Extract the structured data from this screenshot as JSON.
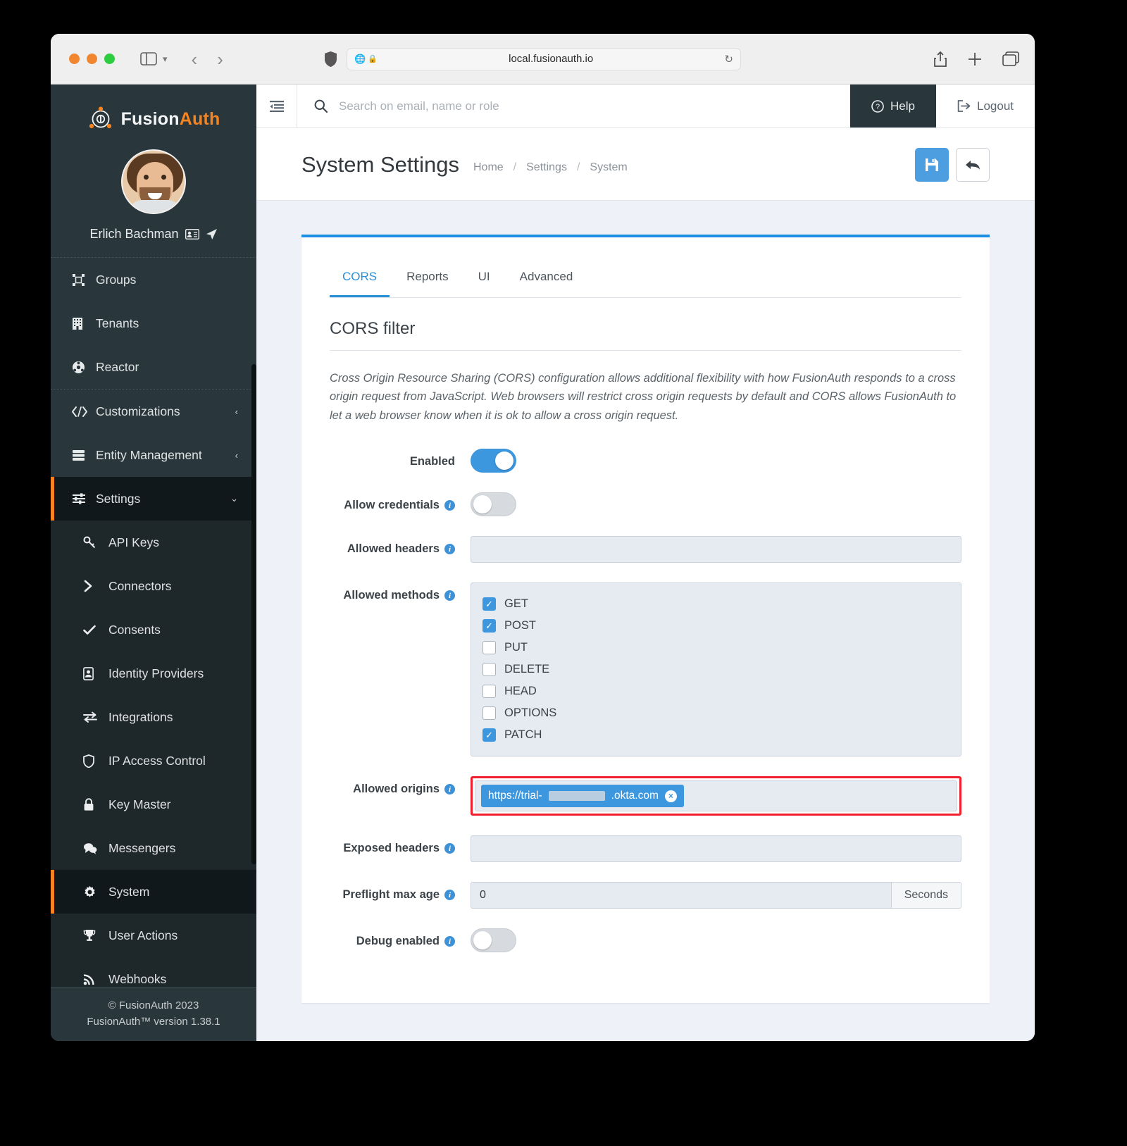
{
  "browser": {
    "url": "local.fusionauth.io",
    "reload_icon": "reload-icon",
    "share_icon": "share-icon",
    "newtab_icon": "plus-icon",
    "tabs_icon": "tabs-icon",
    "shield_icon": "shield-icon",
    "back_icon": "chevron-left-icon",
    "forward_icon": "chevron-right-icon",
    "sidebar_icon": "sidebar-icon"
  },
  "sidebar": {
    "brand_first": "Fusion",
    "brand_second": "Auth",
    "user_name": "Erlich Bachman",
    "items": [
      {
        "label": "Groups",
        "icon": "groups-icon"
      },
      {
        "label": "Tenants",
        "icon": "building-icon"
      },
      {
        "label": "Reactor",
        "icon": "reactor-icon"
      }
    ],
    "expandable": [
      {
        "label": "Customizations",
        "icon": "code-icon",
        "chevron": "‹"
      },
      {
        "label": "Entity Management",
        "icon": "server-icon",
        "chevron": "‹"
      }
    ],
    "settings": {
      "label": "Settings",
      "icon": "sliders-icon",
      "chevron": "⌄"
    },
    "sub_items": [
      {
        "label": "API Keys",
        "icon": "key-icon"
      },
      {
        "label": "Connectors",
        "icon": "chevron-right-icon"
      },
      {
        "label": "Consents",
        "icon": "check-icon"
      },
      {
        "label": "Identity Providers",
        "icon": "id-badge-icon"
      },
      {
        "label": "Integrations",
        "icon": "exchange-icon"
      },
      {
        "label": "IP Access Control",
        "icon": "shield-icon"
      },
      {
        "label": "Key Master",
        "icon": "lock-icon"
      },
      {
        "label": "Messengers",
        "icon": "comments-icon"
      },
      {
        "label": "System",
        "icon": "gear-icon",
        "active": true
      },
      {
        "label": "User Actions",
        "icon": "trophy-icon"
      },
      {
        "label": "Webhooks",
        "icon": "rss-icon"
      }
    ],
    "footer_line1": "© FusionAuth 2023",
    "footer_line2": "FusionAuth™ version 1.38.1"
  },
  "topbar": {
    "collapse_icon": "collapse-sidebar-icon",
    "search_placeholder": "Search on email, name or role",
    "search_value": "",
    "help_label": "Help",
    "help_icon": "question-circle-icon",
    "logout_label": "Logout",
    "logout_icon": "sign-out-icon"
  },
  "page": {
    "title": "System Settings",
    "breadcrumb": [
      "Home",
      "Settings",
      "System"
    ],
    "breadcrumb_separator": "/",
    "save_icon": "save-icon",
    "back_icon": "undo-arrow-icon"
  },
  "tabs": [
    {
      "label": "CORS",
      "active": true
    },
    {
      "label": "Reports",
      "active": false
    },
    {
      "label": "UI",
      "active": false
    },
    {
      "label": "Advanced",
      "active": false
    }
  ],
  "cors": {
    "heading": "CORS filter",
    "description": "Cross Origin Resource Sharing (CORS) configuration allows additional flexibility with how FusionAuth responds to a cross origin request from JavaScript. Web browsers will restrict cross origin requests by default and CORS allows FusionAuth to let a web browser know when it is ok to allow a cross origin request.",
    "enabled": {
      "label": "Enabled",
      "value": true
    },
    "allow_credentials": {
      "label": "Allow credentials",
      "value": false
    },
    "allowed_headers": {
      "label": "Allowed headers",
      "value": ""
    },
    "allowed_methods": {
      "label": "Allowed methods",
      "options": [
        {
          "label": "GET",
          "checked": true
        },
        {
          "label": "POST",
          "checked": true
        },
        {
          "label": "PUT",
          "checked": false
        },
        {
          "label": "DELETE",
          "checked": false
        },
        {
          "label": "HEAD",
          "checked": false
        },
        {
          "label": "OPTIONS",
          "checked": false
        },
        {
          "label": "PATCH",
          "checked": true
        }
      ]
    },
    "allowed_origins": {
      "label": "Allowed origins",
      "chip_prefix": "https://trial-",
      "chip_suffix": ".okta.com",
      "chip_remove_icon": "remove-chip-icon",
      "highlight_color": "#f01f2e"
    },
    "exposed_headers": {
      "label": "Exposed headers",
      "value": ""
    },
    "preflight_max_age": {
      "label": "Preflight max age",
      "value": "0",
      "unit": "Seconds"
    },
    "debug_enabled": {
      "label": "Debug enabled",
      "value": false
    }
  },
  "colors": {
    "accent": "#3d97df",
    "brand_orange": "#f58320",
    "sidebar_bg": "#29373c"
  }
}
